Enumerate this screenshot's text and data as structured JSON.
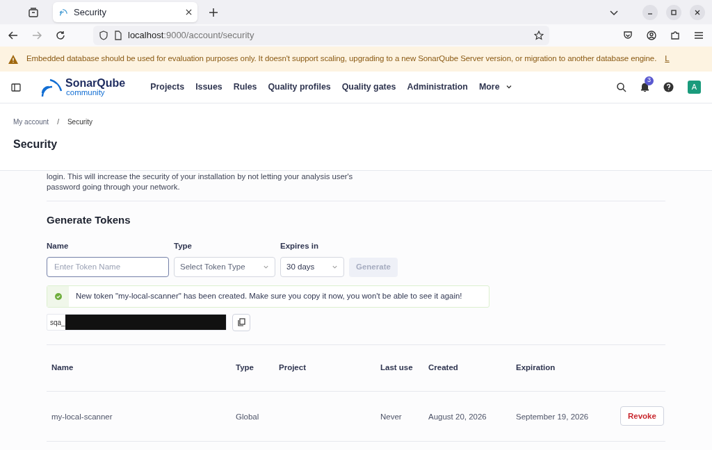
{
  "browser": {
    "tab_title": "Security",
    "url_host": "localhost",
    "url_path": ":9000/account/security"
  },
  "banner": {
    "text": "Embedded database should be used for evaluation purposes only. It doesn't support scaling, upgrading to a new SonarQube Server version, or migration to another database engine.",
    "link": "L"
  },
  "nav": {
    "logo_name": "SonarQube",
    "logo_edition": "community",
    "items": [
      {
        "label": "Projects",
        "dropdown": false
      },
      {
        "label": "Issues",
        "dropdown": false
      },
      {
        "label": "Rules",
        "dropdown": false
      },
      {
        "label": "Quality profiles",
        "dropdown": false
      },
      {
        "label": "Quality gates",
        "dropdown": false
      },
      {
        "label": "Administration",
        "dropdown": false
      },
      {
        "label": "More",
        "dropdown": true
      }
    ],
    "notification_count": "3",
    "avatar": "A"
  },
  "breadcrumbs": [
    "My account",
    "Security"
  ],
  "breadcrumb_separator": "/",
  "page_title": "Security",
  "intro_lines": [
    "login. This will increase the security of your installation by not letting your analysis user's",
    "password going through your network."
  ],
  "generate": {
    "title": "Generate Tokens",
    "name_label": "Name",
    "name_placeholder": "Enter Token Name",
    "type_label": "Type",
    "type_placeholder": "Select Token Type",
    "expires_label": "Expires in",
    "expires_value": "30 days",
    "button": "Generate",
    "button_disabled": true
  },
  "alert": {
    "text": "New token \"my-local-scanner\" has been created. Make sure you copy it now, you won't be able to see it again!"
  },
  "token_prefix": "sqa_",
  "table": {
    "columns": [
      "Name",
      "Type",
      "Project",
      "Last use",
      "Created",
      "Expiration"
    ],
    "rows": [
      {
        "cells": [
          "my-local-scanner",
          "Global",
          "",
          "Never",
          "August 20, 2026",
          "September 19, 2026"
        ],
        "action": "Revoke"
      }
    ]
  }
}
